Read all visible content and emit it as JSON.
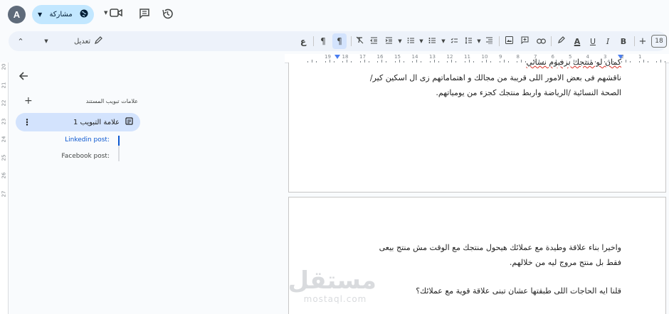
{
  "topbar": {
    "avatar_letter": "A",
    "share_label": "مشاركة"
  },
  "toolbar": {
    "mode_label": "تعديل",
    "font_size": "18"
  },
  "ruler": {
    "numbers": [
      "1",
      "2",
      "3",
      "4",
      "5",
      "6",
      "7",
      "8",
      "9",
      "10",
      "11",
      "12",
      "13",
      "14",
      "15",
      "16",
      "17",
      "18",
      "19"
    ],
    "vertical_numbers": [
      "20",
      "21",
      "22",
      "23",
      "24",
      "25",
      "26",
      "27"
    ]
  },
  "sidebar": {
    "tabs_label": "علامات تبويب المستند",
    "tab_label": "علامة التبويب 1",
    "headings": [
      {
        "text": "Linkedin post:",
        "active": true
      },
      {
        "text": "Facebook post:",
        "active": false
      }
    ]
  },
  "document": {
    "page1_lines": [
      "كمان لو منتجك بزفيوم نسائي",
      "ناقشهم فى بعض الامور اللى قريبة من مجالك و اهتماماتهم زى ال اسكين كير/",
      "الصحة النسائية /الرياضة واربط منتجك كجزء من يومياتهم."
    ],
    "page2_lines": [
      "واخيرا بناء علاقة وطيدة مع عملائك هيحول منتجك مع الوقت مش منتج بيعى",
      "فقط بل منتج مروج ليه من خلالهم.",
      "قلنا ايه الحاجات اللى طبقتها عشان تبنى علاقة قوية مع عملائك؟"
    ]
  },
  "watermark": {
    "main": "مستقل",
    "sub": "mostaql.com"
  },
  "colors": {
    "share_bg": "#c2e7ff",
    "tab_pill_bg": "#d3e3fd",
    "active_heading": "#0b57d0",
    "toolbar_bg": "#edf2fa"
  }
}
